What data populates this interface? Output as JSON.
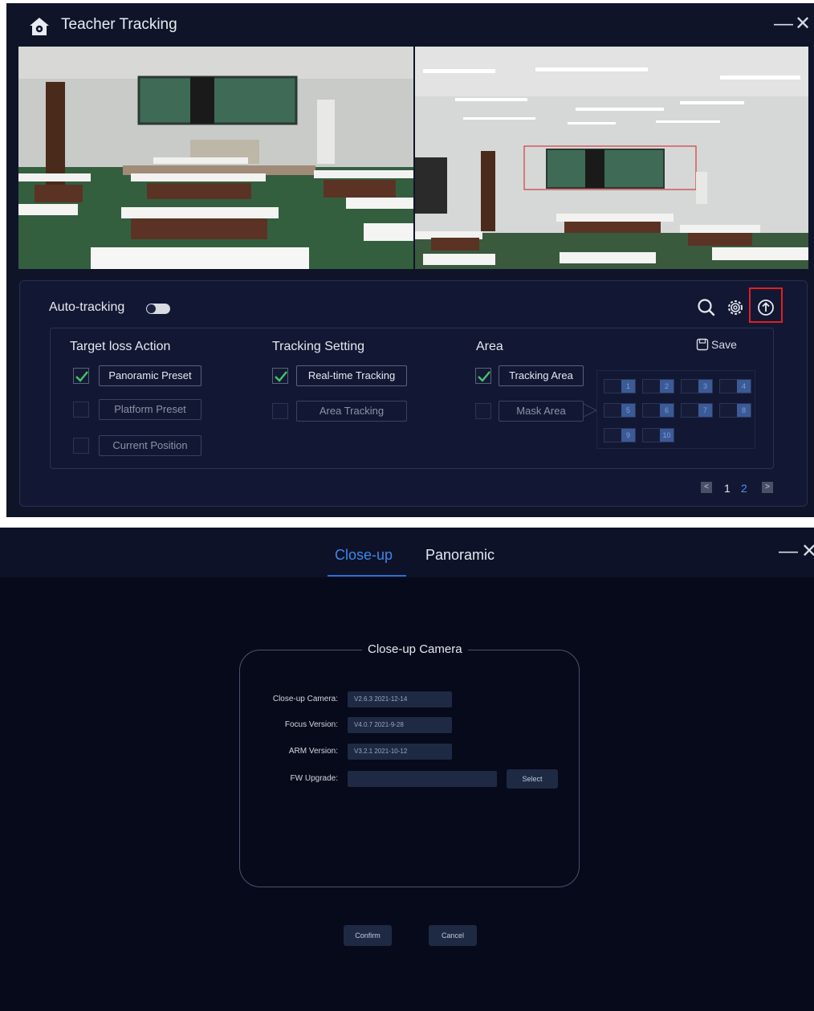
{
  "window1": {
    "title": "Teacher Tracking",
    "icons": {
      "home": "home-icon",
      "minimize": "minimize-icon",
      "close": "close-icon"
    },
    "minimize_label": "—",
    "close_label": "✕"
  },
  "panel": {
    "auto_tracking_label": "Auto-tracking",
    "auto_tracking_on": false,
    "tool_icons": [
      "search-icon",
      "gear-icon",
      "upload-icon"
    ],
    "save_label": "Save",
    "columns": [
      {
        "heading": "Target loss Action",
        "options": [
          {
            "label": "Panoramic Preset",
            "checked": true
          },
          {
            "label": "Platform Preset",
            "checked": false
          },
          {
            "label": "Current Position",
            "checked": false
          }
        ]
      },
      {
        "heading": "Tracking Setting",
        "options": [
          {
            "label": "Real-time Tracking",
            "checked": true
          },
          {
            "label": "Area Tracking",
            "checked": false
          }
        ]
      },
      {
        "heading": "Area",
        "options": [
          {
            "label": "Tracking Area",
            "checked": true
          },
          {
            "label": "Mask Area",
            "checked": false
          }
        ]
      }
    ],
    "area_cells": [
      "1",
      "2",
      "3",
      "4",
      "5",
      "6",
      "7",
      "8",
      "9",
      "10"
    ],
    "pages": [
      "1",
      "2"
    ],
    "current_page": "1",
    "accent_color": "#4f8ef0"
  },
  "window2": {
    "tabs": [
      {
        "label": "Close-up",
        "active": true
      },
      {
        "label": "Panoramic",
        "active": false
      }
    ],
    "minimize_label": "—",
    "close_label": "✕",
    "group_title": "Close-up Camera",
    "fields": [
      {
        "label": "Close-up Camera:",
        "value": "V2.6.3  2021-12-14"
      },
      {
        "label": "Focus Version:",
        "value": "V4.0.7  2021-9-28"
      },
      {
        "label": "ARM Version:",
        "value": "V3.2.1  2021-10-12"
      }
    ],
    "fw_label": "FW Upgrade:",
    "fw_value": "",
    "select_label": "Select",
    "confirm_label": "Confirm",
    "cancel_label": "Cancel"
  }
}
